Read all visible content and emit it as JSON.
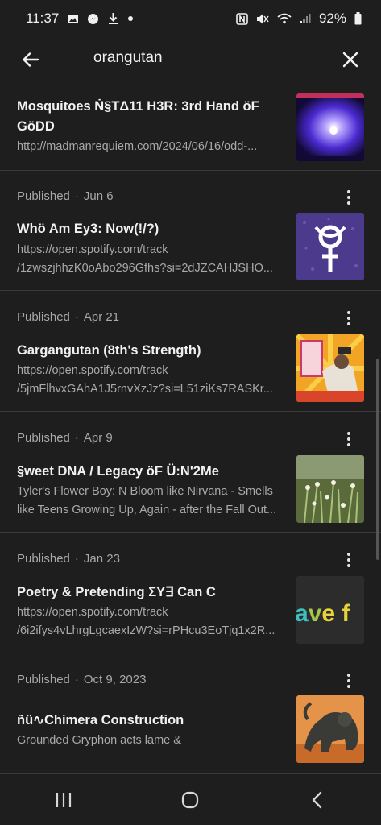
{
  "status_bar": {
    "time": "11:37",
    "battery": "92%",
    "left_icons": [
      "image-icon",
      "messenger-icon",
      "download-icon",
      "dot-icon"
    ],
    "right_icons": [
      "nfc-icon",
      "mute-icon",
      "wifi-icon",
      "signal-icon",
      "battery-icon"
    ]
  },
  "search": {
    "query": "orangutan"
  },
  "results": [
    {
      "title_lines": [
        "Mosquitoes Ṅ§TΔ11 H3R: 3rd Hand öF",
        "GöDD"
      ],
      "sub_lines": [
        "http://madmanrequiem.com/2024/06/16/odd-..."
      ],
      "thumbnail": "purple-light-photo"
    },
    {
      "status": "Published",
      "date": "Jun 6",
      "title_lines": [
        "Whö Am Ey3: Now(!/?)"
      ],
      "sub_lines": [
        "https://open.spotify.com/track",
        "/1zwszjhhzK0oAbo296Gfhs?si=2dJZCAHJSHO..."
      ],
      "thumbnail": "love-symbol-art"
    },
    {
      "status": "Published",
      "date": "Apr 21",
      "title_lines": [
        "Gargangutan (8th's Strength)"
      ],
      "sub_lines": [
        "https://open.spotify.com/track",
        "/5jmFlhvxGAhA1J5rnvXzJz?si=L51ziKs7RASKr..."
      ],
      "thumbnail": "tarot-card-art"
    },
    {
      "status": "Published",
      "date": "Apr 9",
      "title_lines": [
        "§weet DNA / Legacy öF Ü:N'2Me"
      ],
      "sub_lines": [
        "Tyler's Flower Boy: N Bloom like Nirvana - Smells",
        "like Teens Growing Up, Again - after the Fall Out..."
      ],
      "thumbnail": "flower-photo"
    },
    {
      "status": "Published",
      "date": "Jan 23",
      "title_lines": [
        "Poetry & Pretending ΣΥ∃ Can C"
      ],
      "sub_lines": [
        "https://open.spotify.com/track",
        "/6i2ifys4vLhrgLgcaexIzW?si=rPHcu3EoTjq1x2R..."
      ],
      "thumbnail": "text-art",
      "thumbnail_text": "ave f"
    },
    {
      "status": "Published",
      "date": "Oct 9, 2023",
      "title_lines": [
        "ñü∿Chimera Construction"
      ],
      "sub_lines": [
        "Grounded Gryphon acts lame &"
      ],
      "thumbnail": "chimera-statue-photo"
    }
  ],
  "colors": {
    "background": "#1e1e1e",
    "divider": "#3a3a3a",
    "text_primary": "#f1f1f1",
    "text_secondary": "#a9a9a9"
  }
}
